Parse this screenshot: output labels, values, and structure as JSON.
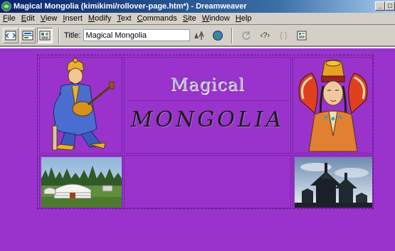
{
  "window": {
    "title": "Magical Mongolia (kimikimi/rollover-page.htm*) - Dreamweaver",
    "minimize_label": "_",
    "maximize_label": "□"
  },
  "menubar": {
    "items": [
      {
        "label": "File",
        "key": "F",
        "rest": "ile"
      },
      {
        "label": "Edit",
        "key": "E",
        "rest": "dit"
      },
      {
        "label": "View",
        "key": "V",
        "rest": "iew"
      },
      {
        "label": "Insert",
        "key": "I",
        "rest": "nsert"
      },
      {
        "label": "Modify",
        "key": "M",
        "rest": "odify"
      },
      {
        "label": "Text",
        "key": "T",
        "rest": "ext"
      },
      {
        "label": "Commands",
        "key": "C",
        "rest": "ommands"
      },
      {
        "label": "Site",
        "key": "S",
        "rest": "ite"
      },
      {
        "label": "Window",
        "key": "W",
        "rest": "indow"
      },
      {
        "label": "Help",
        "key": "H",
        "rest": "elp"
      }
    ]
  },
  "toolbar": {
    "title_label": "Title:",
    "title_value": "Magical Mongolia",
    "code_view_label": "‹?›",
    "braces_label": "{ }"
  },
  "document": {
    "heading_top": "Magical",
    "heading_bottom": "MONGOLIA",
    "background_color": "#9933cc"
  }
}
